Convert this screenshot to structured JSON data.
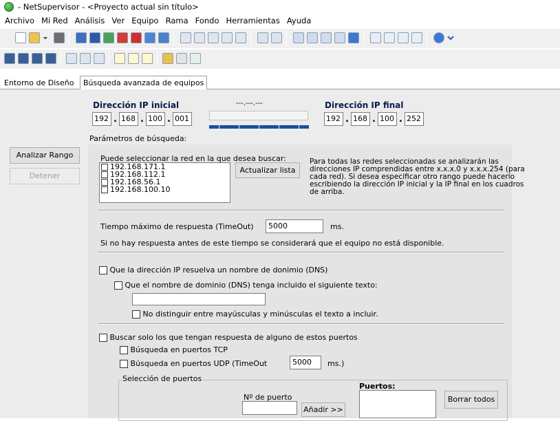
{
  "window": {
    "title": "- NetSupervisor -  <Proyecto actual sin título>"
  },
  "menu": [
    "Archivo",
    "Mi Red",
    "Análisis",
    "Ver",
    "Equipo",
    "Rama",
    "Fondo",
    "Herramientas",
    "Ayuda"
  ],
  "tabs": [
    {
      "label": "Entorno de Diseño",
      "active": false
    },
    {
      "label": "Búsqueda avanzada de equipos",
      "active": true
    }
  ],
  "actions": {
    "analyze_label": "Analizar Rango",
    "stop_label": "Detener"
  },
  "ip_range": {
    "start_label": "Dirección IP inicial",
    "end_label": "Dirección IP final",
    "start": [
      "192",
      "168",
      "100",
      "001"
    ],
    "end": [
      "192",
      "168",
      "100",
      "252"
    ],
    "current_ip": "---.---.---",
    "progress_segments": 10
  },
  "params": {
    "section_label": "Parámetros de búsqueda:",
    "network_prompt": "Puede seleccionar la red en la que desea buscar:",
    "networks": [
      "192.168.171.1",
      "192.168.112.1",
      "192.168.56.1",
      "192.168.100.10"
    ],
    "refresh_label": "Actualizar lista",
    "network_note": "Para todas las redes seleccionadas se analizarán las direcciones IP comprendidas entre x.x.x.0 y x.x.x.254 (para cada red). Si desea especificar otro rango puede hacerlo escribiendo la dirección IP inicial y la IP final en los cuadros de arriba.",
    "timeout_label": "Tiempo máximo de respuesta (TimeOut)",
    "timeout_value": "5000",
    "timeout_unit": "ms.",
    "timeout_note": "Si no hay respuesta antes de este tiempo se considerará que el equipo no está disponible.",
    "dns_check_label": "Que la dirección IP resuelva un nombre de donimio (DNS)",
    "dns_contains_label": "Que el nombre de dominio (DNS) tenga incluido el siguiente texto:",
    "dns_text_value": "",
    "case_insensitive_label": "No distinguir entre mayúsculas y minúsculas el texto a incluir.",
    "ports_check_label": "Buscar solo los que tengan respuesta de alguno de estos puertos",
    "tcp_label": "Búsqueda en puertos TCP",
    "udp_label": "Búsqueda en puertos UDP (TimeOut",
    "udp_timeout_value": "5000",
    "udp_timeout_unit": "ms.)",
    "port_selection_label": "Selección de puertos",
    "port_number_label": "Nº de puerto",
    "port_number_value": "",
    "add_label": "Añadir >>",
    "ports_list_label": "Puertos:",
    "clear_all_label": "Borrar todos"
  },
  "colors": {
    "progress": "#1b4f9a",
    "ip_label": "#0a1a4a",
    "panel": "#ececec"
  }
}
